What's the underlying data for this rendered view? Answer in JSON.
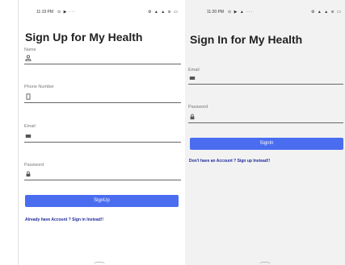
{
  "signup": {
    "status_time": "11:19 PM",
    "status_left_icons": "⊙ ▶ ···",
    "status_right_icons": "⚙ ▲ ▲ ≋ ▭",
    "title": "Sign Up for My Health",
    "name_label": "Name",
    "phone_label": "Phone Number",
    "email_label": "Email",
    "password_label": "Password",
    "button_label": "SignUp",
    "switch_link": "Already have Account ? Sign in Instead!!"
  },
  "signin": {
    "status_time": "11:20 PM",
    "status_left_icons": "⊙ ▶ ▲ ···",
    "status_right_icons": "⚙ ▲ ▲ ≋ ▭",
    "title": "Sign In for My Health",
    "email_label": "Email",
    "password_label": "Password",
    "button_label": "SignIn",
    "switch_link": "Don't have an Account ? Sign up Instead!!"
  },
  "colors": {
    "accent": "#4a6df0",
    "link": "#1f2a9a"
  },
  "icons": {
    "name": "person-icon",
    "phone": "phone-icon",
    "email": "mail-icon",
    "password": "lock-icon"
  }
}
